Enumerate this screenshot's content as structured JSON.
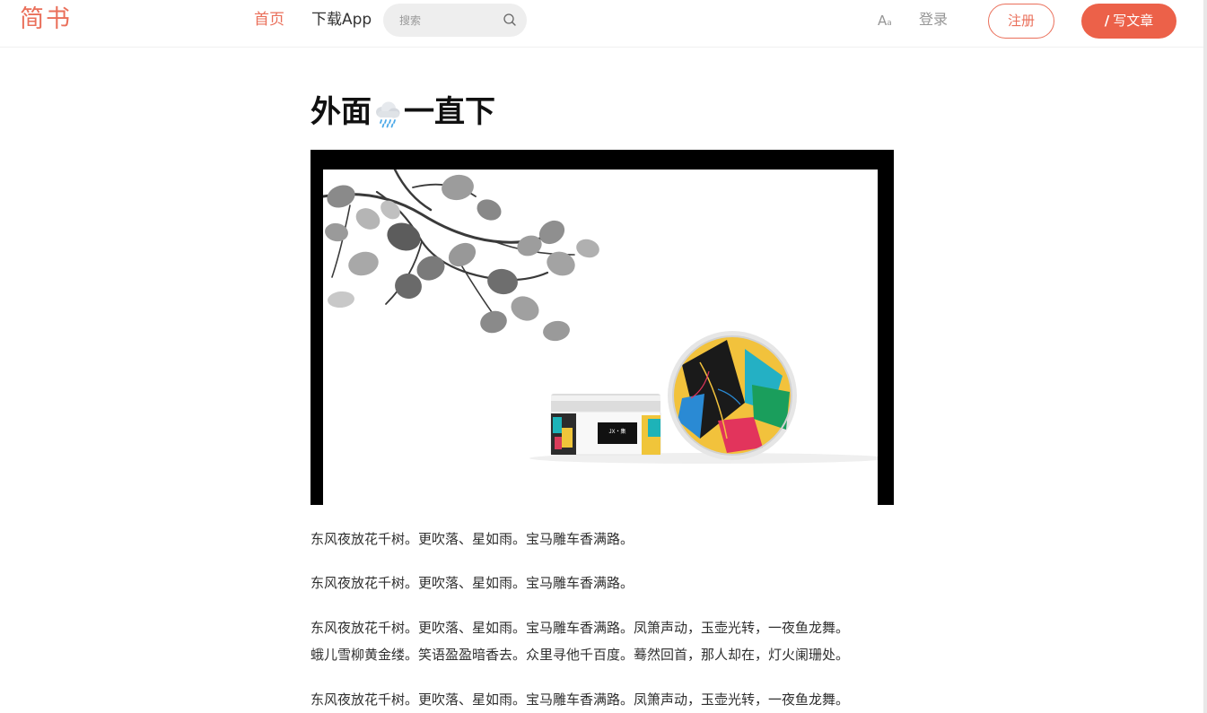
{
  "nav": {
    "logo": "简书",
    "home": "首页",
    "download_app": "下载App",
    "search_placeholder": "搜索",
    "font_toggle_big": "A",
    "font_toggle_small": "a",
    "login": "登录",
    "signup": "注册",
    "write": "写文章"
  },
  "article": {
    "title_before": "外面",
    "title_icon": "rain-cloud-icon",
    "title_after": "一直下",
    "paragraphs": [
      "东风夜放花千树。更吹落、星如雨。宝马雕车香满路。",
      "东风夜放花千树。更吹落、星如雨。宝马雕车香满路。",
      "东风夜放花千树。更吹落、星如雨。宝马雕车香满路。凤箫声动，玉壶光转，一夜鱼龙舞。",
      "蛾儿雪柳黄金缕。笑语盈盈暗香去。众里寻他千百度。蓦然回首，那人却在，灯火阑珊处。",
      "东风夜放花千树。更吹落、星如雨。宝马雕车香满路。凤箫声动，玉壶光转，一夜鱼龙舞。"
    ],
    "jar_label": "JX・集"
  },
  "colors": {
    "accent": "#ea6f5a",
    "write_button": "#ec6149"
  }
}
